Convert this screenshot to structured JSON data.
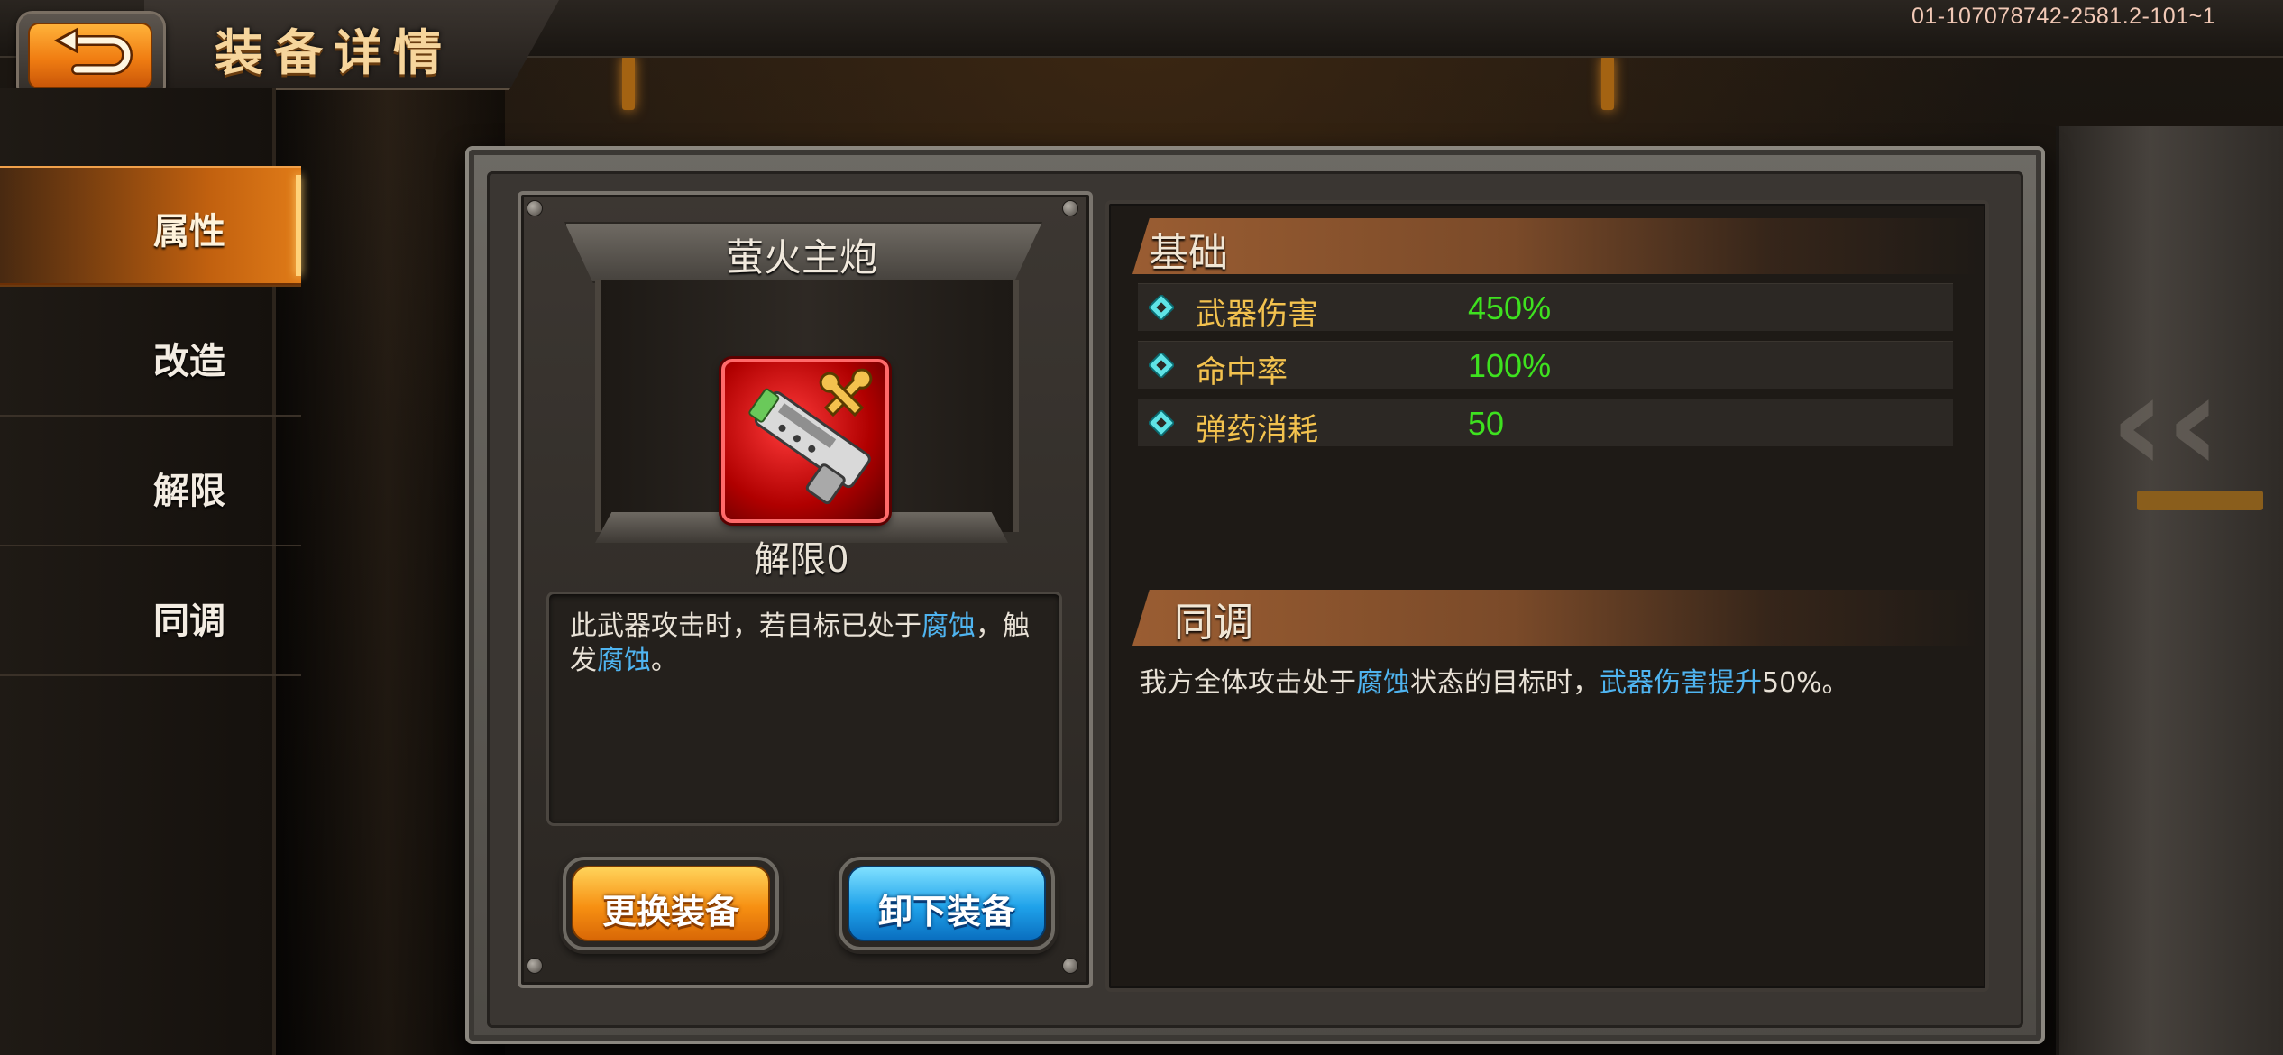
{
  "header": {
    "title": "装备详情",
    "build_id": "01-107078742-2581.2-101~1",
    "back_icon": "back-arrow-icon"
  },
  "sidebar": {
    "items": [
      {
        "label": "属性",
        "active": true
      },
      {
        "label": "改造",
        "active": false
      },
      {
        "label": "解限",
        "active": false
      },
      {
        "label": "同调",
        "active": false
      }
    ]
  },
  "weapon": {
    "name": "萤火主炮",
    "limit": "解限0",
    "icon": "cannon-weapon-icon",
    "badge_icon": "wrench-icon",
    "description": {
      "part1": "此武器攻击时，若目标已处于",
      "hl1": "腐蚀",
      "part2": "，触发",
      "hl2": "腐蚀",
      "part3": "。"
    }
  },
  "buttons": {
    "change": "更换装备",
    "unequip": "卸下装备"
  },
  "basic": {
    "title": "基础",
    "stats": [
      {
        "name": "武器伤害",
        "value": "450%"
      },
      {
        "name": "命中率",
        "value": "100%"
      },
      {
        "name": "弹药消耗",
        "value": "50"
      }
    ]
  },
  "sync": {
    "title": "同调",
    "text": {
      "part1": "我方全体攻击处于",
      "hl1": "腐蚀",
      "part2": "状态的目标时，",
      "hl2": "武器伤害提升",
      "part3": "50%。"
    }
  },
  "colors": {
    "accent_orange": "#f07d12",
    "stat_name": "#f3c24e",
    "stat_value": "#3ee11f",
    "highlight_blue": "#4fb4f0"
  }
}
